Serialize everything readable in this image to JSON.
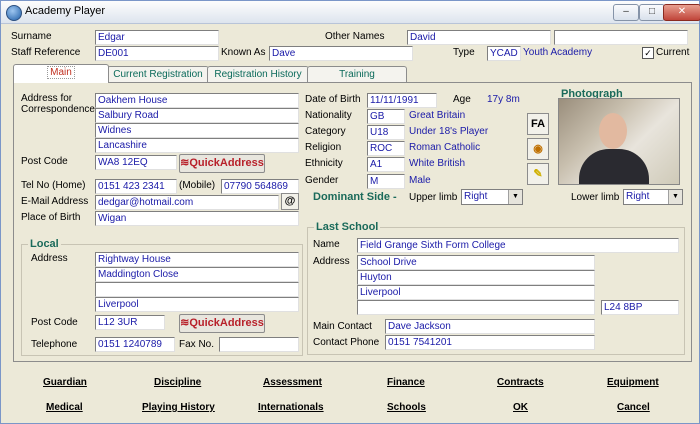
{
  "window": {
    "title": "Academy Player",
    "controls": [
      "–",
      "□",
      "✕"
    ]
  },
  "header": {
    "surname_label": "Surname",
    "surname": "Edgar",
    "other_names_label": "Other Names",
    "other_names": "David",
    "staff_ref_label": "Staff Reference",
    "staff_ref": "DE001",
    "known_as_label": "Known As",
    "known_as": "Dave",
    "type_label": "Type",
    "type_code": "YCAD",
    "type_desc": "Youth Academy",
    "current_label": "Current",
    "current_checked": "✓"
  },
  "tabs": [
    "Main",
    "Current Registration",
    "Registration History",
    "Training"
  ],
  "main": {
    "address_label": "Address for Correspondence",
    "address": [
      "Oakhem House",
      "Salbury Road",
      "Widnes",
      "Lancashire"
    ],
    "postcode_label": "Post Code",
    "postcode": "WA8 12EQ",
    "quick_address": "QuickAddress",
    "tel_label": "Tel No (Home)",
    "tel": "0151 423 2341",
    "mobile_label": "(Mobile)",
    "mobile": "07790 564869",
    "email_label": "E-Mail Address",
    "email": "dedgar@hotmail.com",
    "email_btn": "@",
    "pob_label": "Place of Birth",
    "pob": "Wigan",
    "dob_label": "Date of Birth",
    "dob": "11/11/1991",
    "age_label": "Age",
    "age": "17y 8m",
    "nationality_label": "Nationality",
    "nationality_code": "GB",
    "nationality": "Great Britain",
    "category_label": "Category",
    "category_code": "U18",
    "category": "Under 18's Player",
    "religion_label": "Religion",
    "religion_code": "ROC",
    "religion": "Roman Catholic",
    "ethnicity_label": "Ethnicity",
    "ethnicity_code": "A1",
    "ethnicity": "White British",
    "gender_label": "Gender",
    "gender_code": "M",
    "gender": "Male",
    "dominant_label": "Dominant Side -",
    "upper_limb_label": "Upper limb",
    "upper_limb": "Right",
    "lower_limb_label": "Lower limb",
    "lower_limb": "Right",
    "photo_label": "Photograph",
    "fa_btn": "FA"
  },
  "local": {
    "title": "Local",
    "address_label": "Address",
    "address": [
      "Rightway House",
      "Maddington Close",
      "",
      "Liverpool"
    ],
    "postcode_label": "Post Code",
    "postcode": "L12 3UR",
    "quick_address": "QuickAddress",
    "telephone_label": "Telephone",
    "telephone": "0151 1240789",
    "fax_label": "Fax No.",
    "fax": ""
  },
  "last_school": {
    "title": "Last School",
    "name_label": "Name",
    "name": "Field Grange Sixth Form College",
    "address_label": "Address",
    "address": [
      "School Drive",
      "Huyton",
      "Liverpool",
      ""
    ],
    "postcode": "L24 8BP",
    "contact_label": "Main Contact",
    "contact": "Dave Jackson",
    "phone_label": "Contact Phone",
    "phone": "0151 7541201"
  },
  "bottom_links": {
    "row1": [
      "Guardian",
      "Discipline",
      "Assessment",
      "Finance",
      "Contracts",
      "Equipment"
    ],
    "row2": [
      "Medical",
      "Playing History",
      "Internationals",
      "Schools",
      "OK",
      "Cancel"
    ]
  }
}
